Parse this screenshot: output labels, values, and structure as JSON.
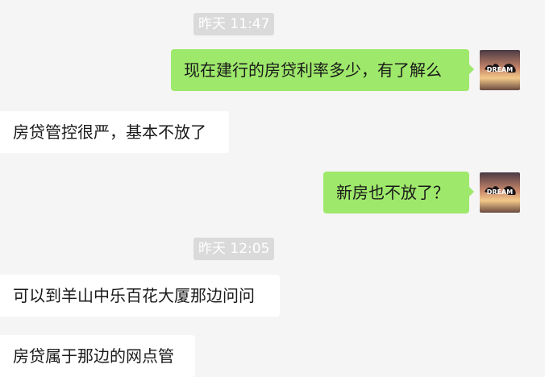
{
  "chat": {
    "messages": [
      {
        "type": "timestamp",
        "text": "昨天 11:47"
      },
      {
        "type": "outgoing",
        "text": "现在建行的房贷利率多少，有了解么"
      },
      {
        "type": "incoming",
        "text": "房贷管控很严，基本不放了"
      },
      {
        "type": "outgoing",
        "text": "新房也不放了？"
      },
      {
        "type": "timestamp",
        "text": "昨天 12:05"
      },
      {
        "type": "incoming",
        "text": "可以到羊山中乐百花大厦那边问问"
      },
      {
        "type": "incoming",
        "text": "房贷属于那边的网点管"
      }
    ]
  },
  "avatar": {
    "icon": "dream-sunset-avatar-icon",
    "label": "DREAM",
    "colors": {
      "sky_top": "#4a3a44",
      "sky_mid": "#c7866a",
      "sky_glow": "#f2c98a",
      "silhouette": "#1b1416"
    }
  },
  "colors": {
    "background": "#f5f5f5",
    "outgoing_bubble": "#9ee86b",
    "incoming_bubble": "#ffffff",
    "timestamp_bg": "#dadada",
    "timestamp_text": "#ffffff",
    "message_text": "#1a1a1a"
  }
}
